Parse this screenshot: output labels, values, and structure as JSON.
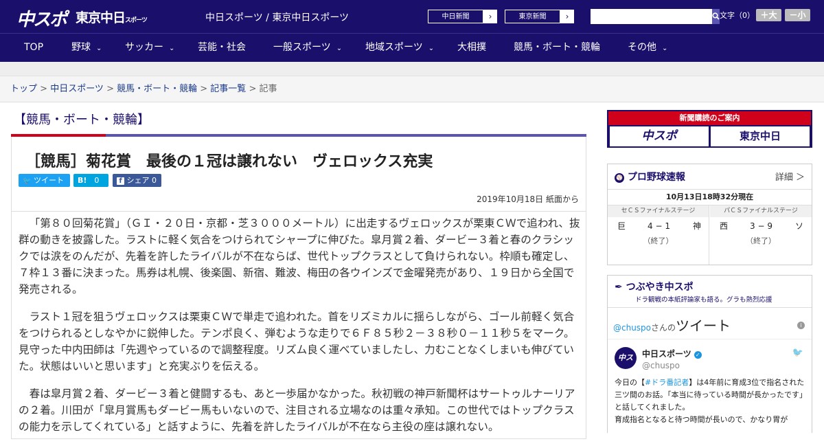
{
  "header": {
    "logo_main": "中スポ",
    "logo_tokyo": "東京中日",
    "logo_tokyo_small": "スポーツ",
    "site_name": "中日スポーツ / 東京中日スポーツ",
    "paper_buttons": [
      {
        "label": "中日新聞",
        "arrow": "›"
      },
      {
        "label": "東京新聞",
        "arrow": "›"
      }
    ],
    "search": {
      "placeholder": "",
      "button_icon": "search-icon",
      "button_glyph": "🔍"
    },
    "font_size_label": "文字（0）",
    "font_larger": "＋大",
    "font_smaller": "－小"
  },
  "nav": {
    "items": [
      {
        "label": "TOP",
        "dropdown": false
      },
      {
        "label": "野球",
        "dropdown": true
      },
      {
        "label": "サッカー",
        "dropdown": true
      },
      {
        "label": "芸能・社会",
        "dropdown": false
      },
      {
        "label": "一般スポーツ",
        "dropdown": true
      },
      {
        "label": "地域スポーツ",
        "dropdown": true
      },
      {
        "label": "大相撲",
        "dropdown": false
      },
      {
        "label": "競馬・ボート・競輪",
        "dropdown": false
      },
      {
        "label": "その他",
        "dropdown": true
      }
    ],
    "caret": "⌄"
  },
  "breadcrumb": {
    "items": [
      "トップ",
      "中日スポーツ",
      "競馬・ボート・競輪",
      "記事一覧"
    ],
    "current": "記事",
    "separator": " > "
  },
  "section": {
    "title": "【競馬・ボート・競輪】"
  },
  "article": {
    "headline": "［競馬］菊花賞　最後の１冠は譲れない　ヴェロックス充実",
    "share": {
      "tweet": "ツイート",
      "hatena": "B!",
      "hatena_count": "0",
      "facebook": "シェア",
      "facebook_count": "0"
    },
    "date": "2019年10月18日 紙面から",
    "paragraphs": [
      "「第８０回菊花賞」（ＧＩ・２０日・京都・芝３０００メートル）に出走するヴェロックスが栗東ＣＷで追われ、抜群の動きを披露した。ラストに軽く気合をつけられてシャープに伸びた。皐月賞２着、ダービー３着と春のクラシックでは涙をのんだが、先着を許したライバルが不在ならば、世代トップクラスとして負けられない。枠順も確定し、７枠１３番に決まった。馬券は札幌、後楽園、新宿、難波、梅田の各ウインズで金曜発売があり、１９日から全国で発売される。",
      "ラスト１冠を狙うヴェロックスは栗東ＣＷで単走で追われた。首をリズミカルに揺らしながら、ゴール前軽く気合をつけられるとしなやかに鋭伸した。テンポ良く、弾むような走りで６Ｆ８５秒２－３８秒０－１１秒５をマーク。見守った中内田師は「先週やっているので調整程度。リズム良く運べていましたし、力むことなくしまいも伸びていた。状態はいいと思います」と充実ぶりを伝える。",
      "春は皐月賞２着、ダービー３着と健闘するも、あと一歩届かなかった。秋初戦の神戸新聞杯はサートゥルナーリアの２着。川田が「皐月賞馬もダービー馬もいないので、注目される立場なのは重々承知。この世代ではトップクラスの能力を示してくれている」と話すように、先着を許したライバルが不在なら主役の座は譲れない。"
    ]
  },
  "sidebar": {
    "subscription": {
      "title": "新聞購読のご案内",
      "left": "中スポ",
      "right": "東京中日"
    },
    "baseball": {
      "title": "プロ野球速報",
      "detail": "詳細 ＞",
      "updated": "10月13日18時32分現在",
      "games": [
        {
          "stage": "セＣＳファイナルステージ",
          "home": "巨",
          "score": "4 − 1",
          "away": "神",
          "status": "（終了）"
        },
        {
          "stage": "パＣＳファイナルステージ",
          "home": "西",
          "score": "3 − 9",
          "away": "ソ",
          "status": "（終了）"
        }
      ]
    },
    "tweets": {
      "title": "つぶやき中スポ",
      "subtitle": "ドラ観戦の本紙評論家も語る。グラも熱烈応援",
      "handle_link": "@chuspo",
      "handle_suffix": "さんの",
      "heading": "ツイート",
      "account_name": "中日スポーツ",
      "account_handle": "@chuspo",
      "avatar_text": "中スポ",
      "tweet_prefix": "今日の【",
      "tweet_hashtag": "#ドラ番記者",
      "tweet_body": "】は4年前に育成3位で指名された三ツ間のお話。「本当に待っている時間が長かったです」と話してくれました。",
      "tweet_body2": "育成指名となると待つ時間が長いので、かなり胃が"
    }
  }
}
